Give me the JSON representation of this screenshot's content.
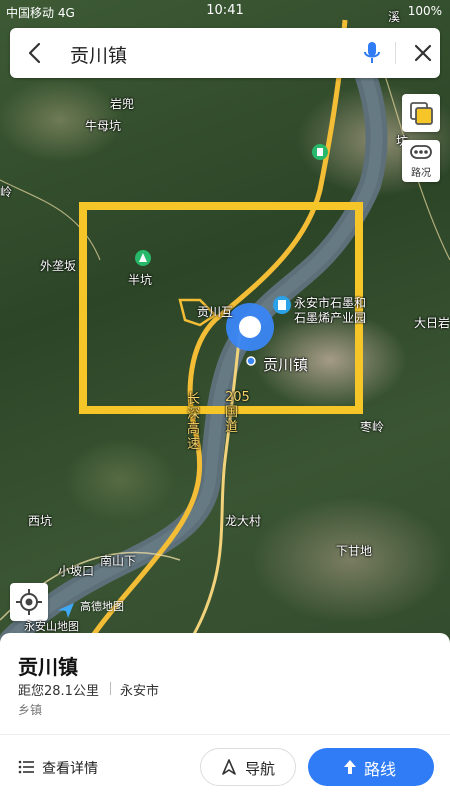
{
  "status_bar": {
    "carrier": "中国移动 4G",
    "time": "10:41",
    "battery": "100%"
  },
  "search": {
    "query": "贡川镇"
  },
  "map_buttons": {
    "traffic_label": "路况"
  },
  "map_labels": {
    "yanbao": "岩兜",
    "niumukeng": "牛母坑",
    "waikeng": "外垄坂",
    "bankeng": "半坑",
    "gongchuan_interchange": "贡川互",
    "factory": "永安市石墨和石墨烯产业园",
    "gongchuan": "贡川镇",
    "dariyan": "大日岩",
    "zaoling": "枣岭",
    "changshen": "长深高速",
    "guodao": "205国道",
    "longdacun": "龙大村",
    "xiakeng": "西坑",
    "nanshanxia": "南山下",
    "xiaopokou": "小坡口",
    "xiaganluo": "下甘地",
    "ling": "岭",
    "fang": "坊",
    "xi": "溪",
    "gaode": "高德地图",
    "yonganshan": "永安山地图"
  },
  "colors": {
    "highlight_box": "#f6c629",
    "pin": "#3a86f5",
    "route_button": "#2f7cf6"
  },
  "place": {
    "name": "贡川镇",
    "distance": "距您28.1公里",
    "city": "永安市",
    "type": "乡镇"
  },
  "actions": {
    "details": "查看详情",
    "navigate": "导航",
    "route": "路线"
  }
}
